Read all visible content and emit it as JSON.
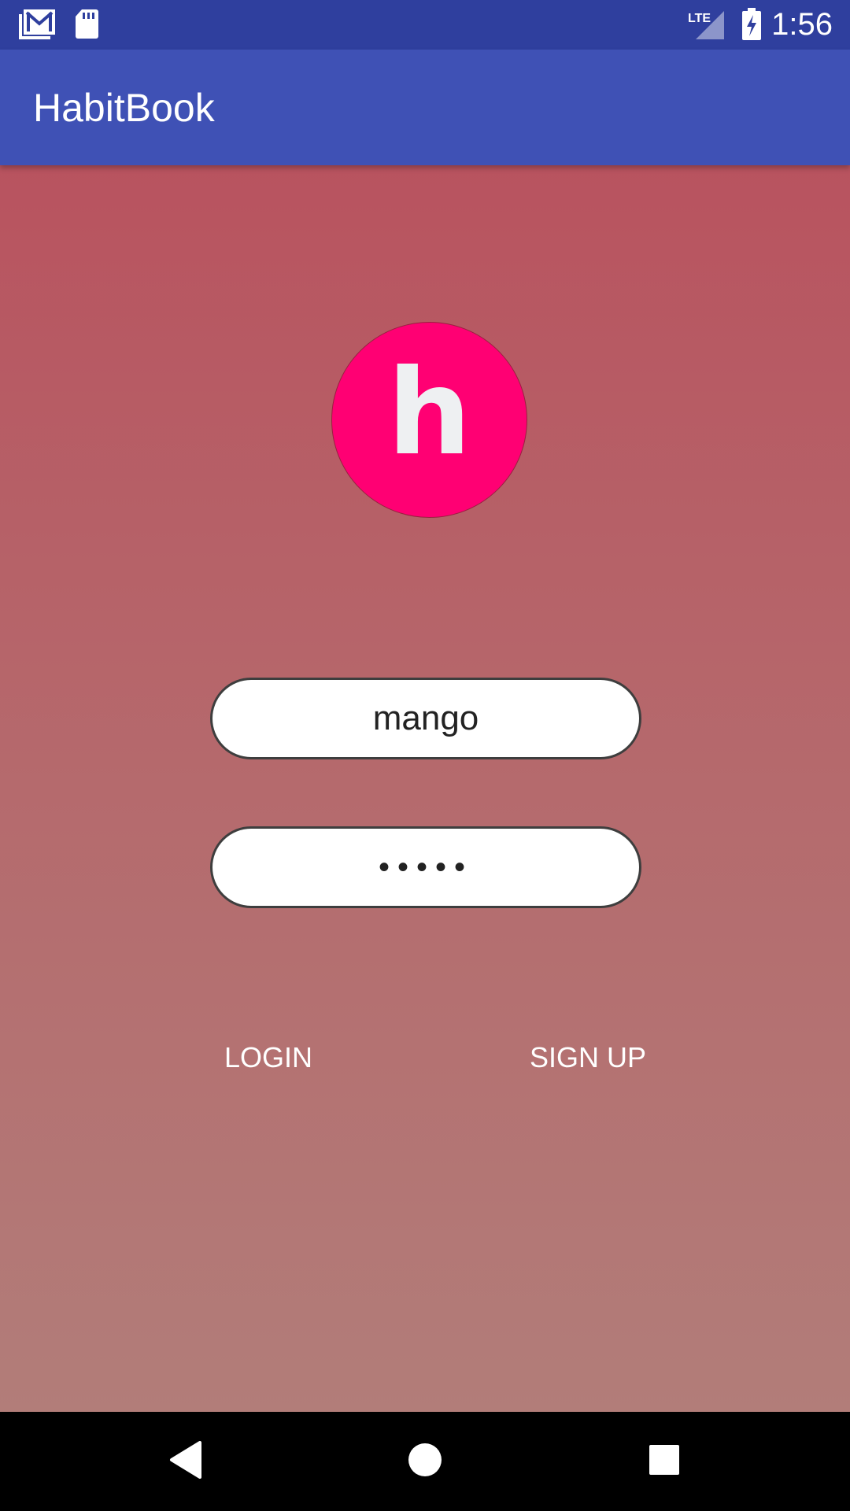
{
  "status_bar": {
    "time": "1:56",
    "icons": [
      "gmail-icon",
      "sd-card-icon",
      "lte-signal-icon",
      "battery-charging-icon"
    ],
    "lte_label": "LTE"
  },
  "app_bar": {
    "title": "HabitBook"
  },
  "logo": {
    "letter": "h",
    "color": "#ff0073"
  },
  "form": {
    "username_value": "mango",
    "password_masked": "•••••"
  },
  "buttons": {
    "login": "LOGIN",
    "signup": "SIGN UP"
  },
  "nav_bar": {
    "icons": [
      "back-icon",
      "home-icon",
      "recents-icon"
    ]
  },
  "colors": {
    "status_bar": "#2f3f9e",
    "app_bar": "#3f51b5",
    "background_top": "#b8535f",
    "background_bottom": "#b27d79"
  }
}
